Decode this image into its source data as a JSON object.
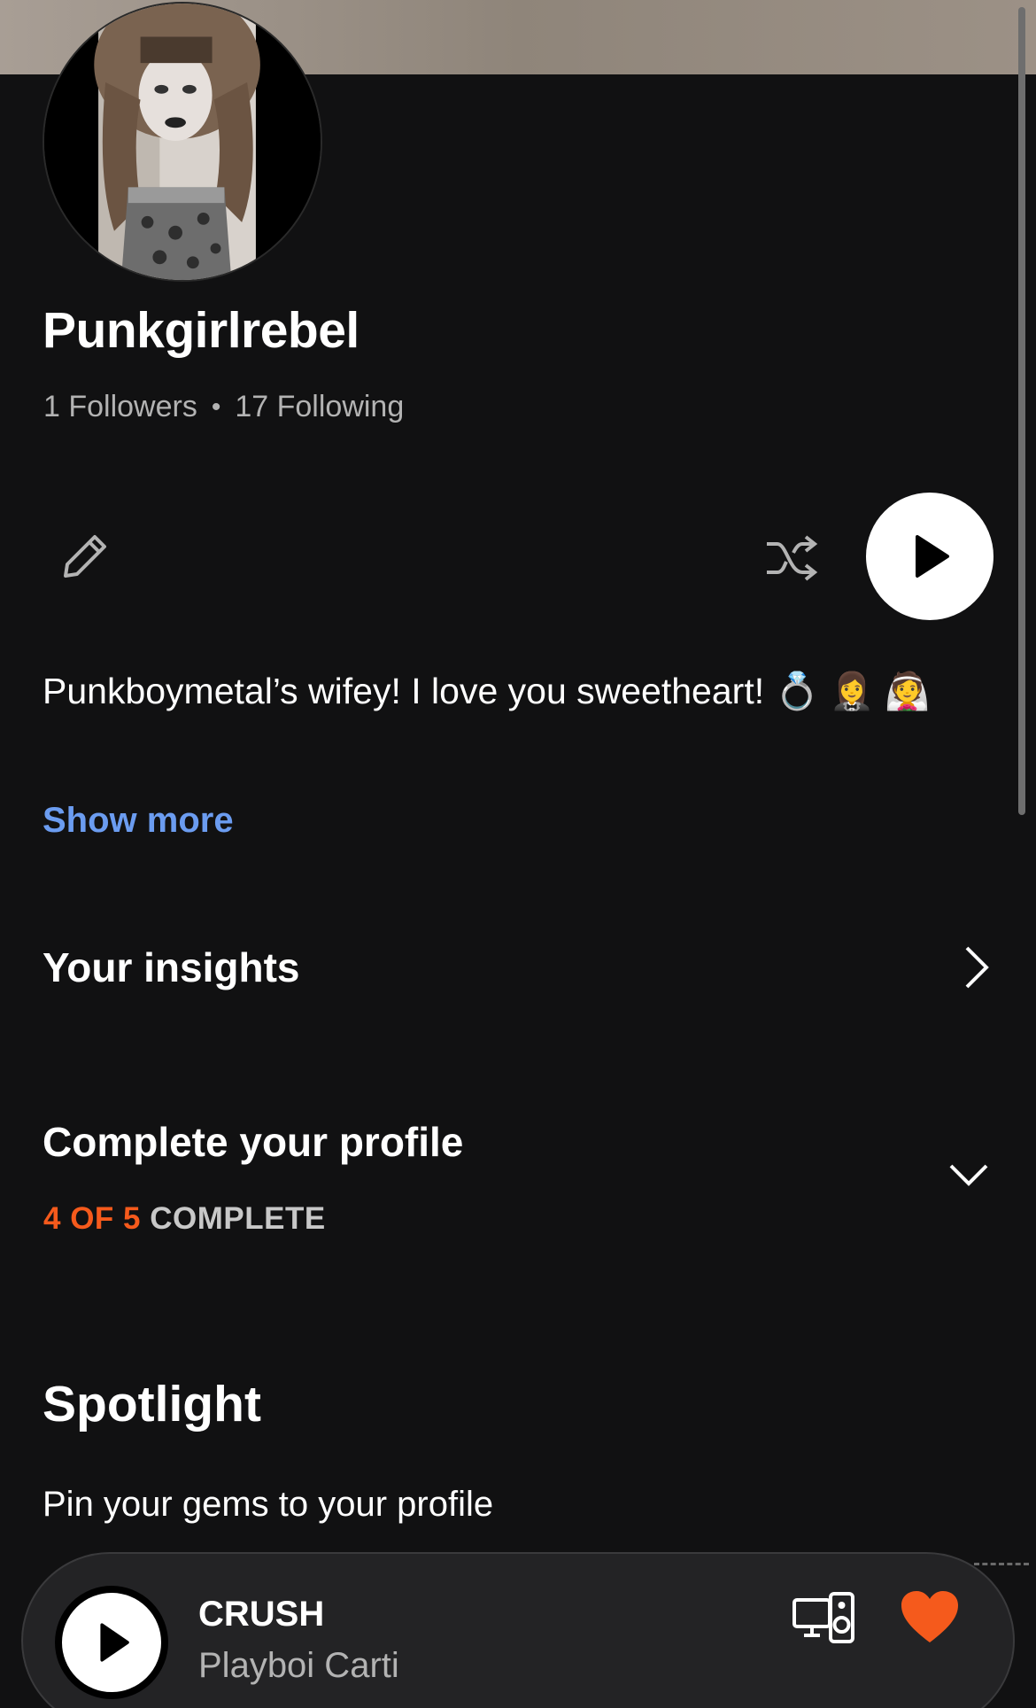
{
  "profile": {
    "username": "Punkgirlrebel",
    "followers": "1 Followers",
    "separator": "•",
    "following": "17 Following"
  },
  "actions": {
    "edit_icon": "pencil-icon",
    "shuffle_icon": "shuffle-icon",
    "play_icon": "play-icon"
  },
  "bio": {
    "text": "Punkboymetal’s wifey! I love you sweetheart! 💍 🤵‍♀️ 👰",
    "show_more": "Show more"
  },
  "insights": {
    "title": "Your insights"
  },
  "complete_profile": {
    "title": "Complete your profile",
    "progress_count": "4 OF 5",
    "progress_word": "COMPLETE",
    "progress_fraction": 0.8
  },
  "spotlight": {
    "title": "Spotlight",
    "subtitle": "Pin your gems to your profile"
  },
  "now_playing": {
    "title": "CRUSH",
    "artist": "Playboi Carti",
    "liked": true
  },
  "colors": {
    "background": "#111112",
    "accent_orange": "#f55a1c",
    "link_blue": "#6b9cf0",
    "secondary_text": "#b3b3b3",
    "player_bg": "#232325"
  }
}
